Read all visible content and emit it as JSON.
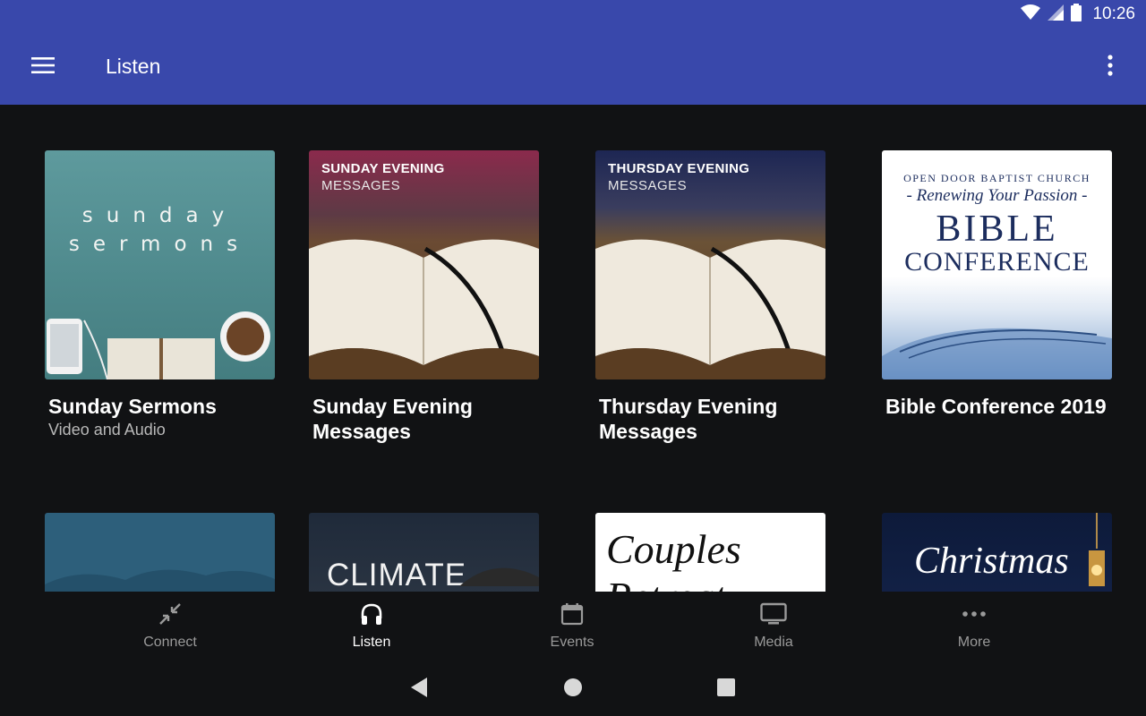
{
  "status": {
    "time": "10:26",
    "wifi_icon": "wifi-icon",
    "signal_icon": "signal-icon",
    "battery_icon": "battery-icon"
  },
  "appbar": {
    "title": "Listen",
    "menu_icon": "hamburger-menu-icon",
    "overflow_icon": "more-vert-icon",
    "color": "#3948ab"
  },
  "cards": [
    {
      "title": "Sunday Sermons",
      "subtitle": "Video and Audio",
      "art_line1": "sunday",
      "art_line2": "sermons"
    },
    {
      "title": "Sunday Evening Messages",
      "subtitle": "",
      "art_heading": "SUNDAY EVENING",
      "art_sub": "MESSAGES"
    },
    {
      "title": "Thursday Evening Messages",
      "subtitle": "",
      "art_heading": "THURSDAY EVENING",
      "art_sub": "MESSAGES"
    },
    {
      "title": "Bible Conference 2019",
      "subtitle": "",
      "art_line1": "OPEN DOOR BAPTIST CHURCH",
      "art_line2": "- Renewing Your Passion -",
      "art_line3": "BIBLE",
      "art_line4": "CONFERENCE"
    },
    {
      "title": "",
      "subtitle": ""
    },
    {
      "title": "",
      "subtitle": "",
      "art_text": "CLIMATE"
    },
    {
      "title": "",
      "subtitle": "",
      "art_text": "Couples Retreat"
    },
    {
      "title": "",
      "subtitle": "",
      "art_text": "Christmas"
    }
  ],
  "bottom_nav": [
    {
      "label": "Connect",
      "icon": "collapse-arrows-icon",
      "active": false
    },
    {
      "label": "Listen",
      "icon": "headphones-icon",
      "active": true
    },
    {
      "label": "Events",
      "icon": "calendar-icon",
      "active": false
    },
    {
      "label": "Media",
      "icon": "monitor-icon",
      "active": false
    },
    {
      "label": "More",
      "icon": "more-horiz-icon",
      "active": false
    }
  ],
  "system_nav": {
    "back_icon": "back-triangle-icon",
    "home_icon": "home-circle-icon",
    "recents_icon": "recents-square-icon"
  }
}
